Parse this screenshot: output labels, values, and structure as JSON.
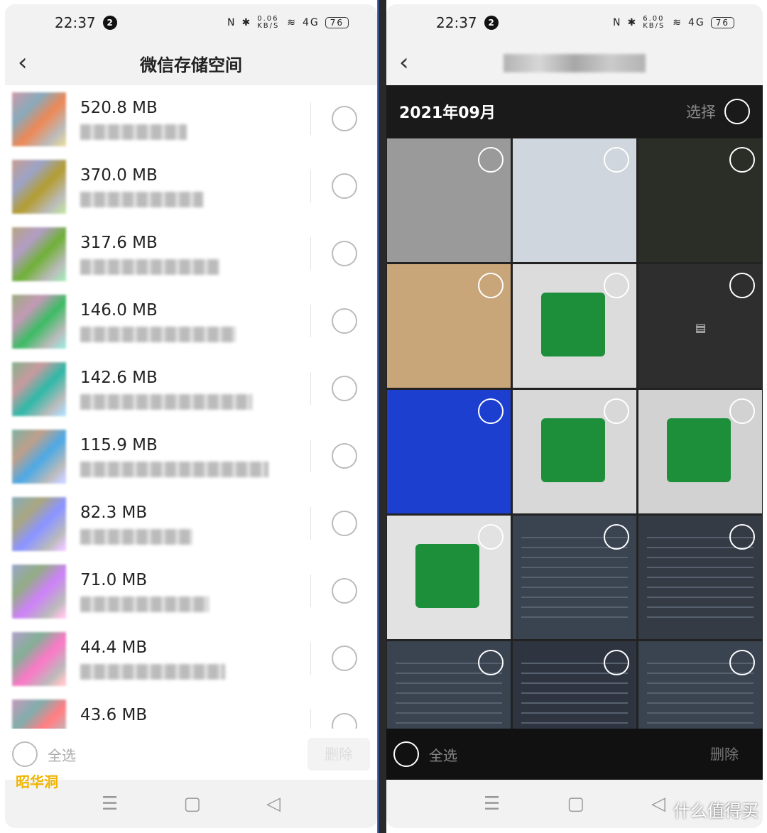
{
  "status": {
    "time": "22:37",
    "notif_count": "2",
    "speed_left": "0.06 KB/S",
    "speed_right": "6.00 KB/S",
    "network": "4G",
    "battery": "76"
  },
  "left": {
    "title": "微信存储空间",
    "items": [
      {
        "size": "520.8 MB"
      },
      {
        "size": "370.0 MB"
      },
      {
        "size": "317.6 MB"
      },
      {
        "size": "146.0 MB"
      },
      {
        "size": "142.6 MB"
      },
      {
        "size": "115.9 MB"
      },
      {
        "size": "82.3 MB"
      },
      {
        "size": "71.0 MB"
      },
      {
        "size": "44.4 MB"
      },
      {
        "size": "43.6 MB"
      }
    ],
    "select_all": "全选",
    "delete": "删除"
  },
  "right": {
    "month": "2021年09月",
    "select": "选择",
    "photos": [
      {
        "desc": "monitor-moire",
        "color": "#9a9a9a"
      },
      {
        "desc": "ssd-boxes",
        "color": "#cfd6dd"
      },
      {
        "desc": "night-city",
        "color": "#2b2e27"
      },
      {
        "desc": "wood-surface",
        "color": "#c9a67a"
      },
      {
        "desc": "green-board",
        "color": "#dcdcdc"
      },
      {
        "desc": "file",
        "color": "#2e2e2e"
      },
      {
        "desc": "blue-screen",
        "color": "#1d3fd0"
      },
      {
        "desc": "green-board",
        "color": "#d8d8d8"
      },
      {
        "desc": "green-board",
        "color": "#d2d2d2"
      },
      {
        "desc": "green-boards",
        "color": "#e2e2e2"
      },
      {
        "desc": "text-screenshot",
        "color": "#3a4350"
      },
      {
        "desc": "text-screenshot",
        "color": "#353b44"
      },
      {
        "desc": "text-screenshot",
        "color": "#3a4350"
      },
      {
        "desc": "text-screenshot",
        "color": "#2f3540"
      },
      {
        "desc": "text-screenshot",
        "color": "#3a4350"
      }
    ],
    "select_all": "全选",
    "delete": "删除"
  },
  "watermarks": {
    "left": "昭华洞",
    "right": "什么值得买"
  }
}
